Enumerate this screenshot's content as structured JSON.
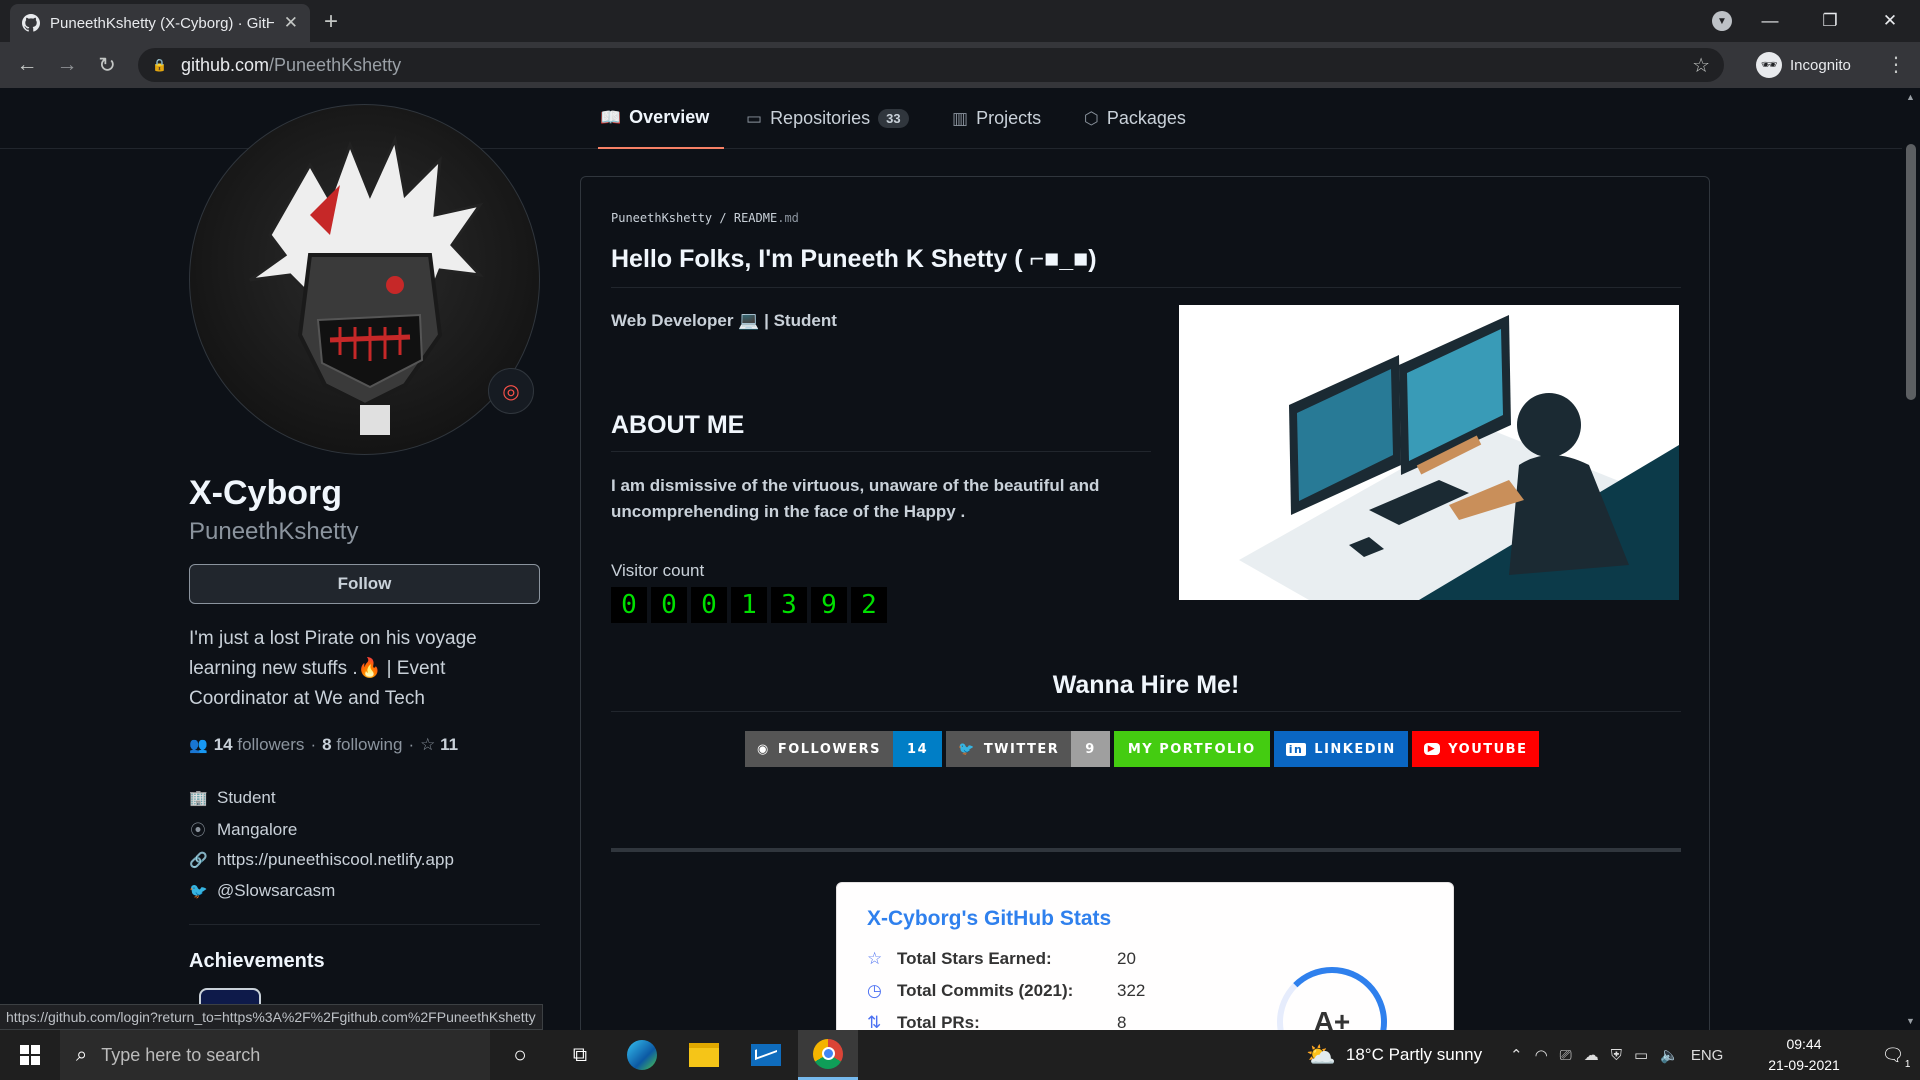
{
  "browser": {
    "tab_title": "PuneethKshetty (X-Cyborg) · GitHub",
    "tab_close": "✕",
    "new_tab": "+",
    "url_host": "github.com",
    "url_path": "/PuneethKshetty",
    "incognito_label": "Incognito",
    "status_url": "https://github.com/login?return_to=https%3A%2F%2Fgithub.com%2FPuneethKshetty"
  },
  "github_nav": {
    "tabs": [
      {
        "label": "Overview",
        "icon": "book-icon",
        "active": true
      },
      {
        "label": "Repositories",
        "icon": "repo-icon",
        "count": "33"
      },
      {
        "label": "Projects",
        "icon": "project-icon"
      },
      {
        "label": "Packages",
        "icon": "package-icon"
      }
    ]
  },
  "profile": {
    "name": "X-Cyborg",
    "login": "PuneethKshetty",
    "follow_label": "Follow",
    "bio": "I'm just a lost Pirate on his voyage learning new stuffs .🔥 | Event Coordinator at We and Tech",
    "followers_count": "14",
    "followers_label": "followers",
    "following_count": "8",
    "following_label": "following",
    "stars_count": "11",
    "separator": "·",
    "company": "Student",
    "location": "Mangalore",
    "website": "https://puneethiscool.netlify.app",
    "twitter": "@Slowsarcasm",
    "achievements_title": "Achievements"
  },
  "readme": {
    "breadcrumb_user": "PuneethKshetty",
    "breadcrumb_sep": "/",
    "breadcrumb_file": "README",
    "breadcrumb_ext": ".md",
    "heading": "Hello Folks, I'm Puneeth K Shetty ( ⌐■_■)",
    "role": "Web Developer 💻 | Student",
    "about_title": "ABOUT ME",
    "about_text": "I am dismissive of the virtuous, unaware of the beautiful and uncomprehending in the face of the Happy .",
    "visitor_label": "Visitor count",
    "visitor_digits": [
      "0",
      "0",
      "0",
      "1",
      "3",
      "9",
      "2"
    ],
    "hire_title": "Wanna Hire Me!",
    "badges": [
      {
        "label": "FOLLOWERS",
        "value": "14",
        "icon": "github-icon",
        "left_color": "#555555",
        "right_color": "#007ec6"
      },
      {
        "label": "TWITTER",
        "value": "9",
        "icon": "twitter-icon",
        "left_color": "#555555",
        "right_color": "#9f9f9f"
      },
      {
        "label": "MY PORTFOLIO",
        "icon": "",
        "left_color": "#44cc11"
      },
      {
        "label": "LINKEDIN",
        "icon": "linkedin-icon",
        "left_color": "#0a66c2"
      },
      {
        "label": "YOUTUBE",
        "icon": "youtube-icon",
        "left_color": "#ff0000"
      }
    ]
  },
  "stats_card": {
    "title": "X-Cyborg's GitHub Stats",
    "rows": [
      {
        "label": "Total Stars Earned:",
        "value": "20",
        "icon": "star-icon"
      },
      {
        "label": "Total Commits (2021):",
        "value": "322",
        "icon": "history-icon"
      },
      {
        "label": "Total PRs:",
        "value": "8",
        "icon": "pull-request-icon"
      }
    ],
    "grade": "A+"
  },
  "taskbar": {
    "search_placeholder": "Type here to search",
    "weather": "18°C  Partly sunny",
    "language": "ENG",
    "time": "09:44",
    "date": "21-09-2021",
    "notification_count": "1"
  }
}
